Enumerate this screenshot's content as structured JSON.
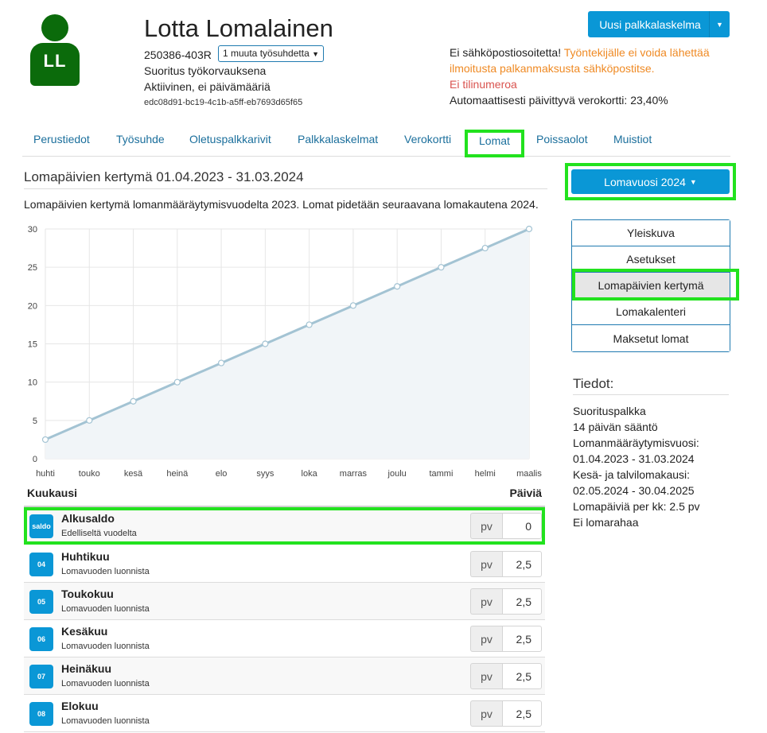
{
  "employee": {
    "initials": "LL",
    "name": "Lotta Lomalainen",
    "ssn": "250386-403R",
    "other_employments": "1 muuta työsuhdetta",
    "status_line1": "Suoritus työkorvauksena",
    "status_line2": "Aktiivinen, ei päivämääriä",
    "uuid": "edc08d91-bc19-4c1b-a5ff-eb7693d65f65",
    "avatar_color": "#0b6b0b"
  },
  "actions": {
    "new_payslip": "Uusi palkkalaskelma"
  },
  "notices": {
    "email_prefix": "Ei sähköpostiosoitetta! ",
    "email_warning": "Työntekijälle ei voida lähettää ilmoitusta palkanmaksusta sähköpostitse.",
    "no_account": "Ei tilinumeroa",
    "tax_card": "Automaattisesti päivittyvä verokortti: 23,40%"
  },
  "tabs": [
    {
      "label": "Perustiedot"
    },
    {
      "label": "Työsuhde"
    },
    {
      "label": "Oletuspalkkarivit"
    },
    {
      "label": "Palkkalaskelmat"
    },
    {
      "label": "Verokortti"
    },
    {
      "label": "Lomat",
      "active": true
    },
    {
      "label": "Poissaolot"
    },
    {
      "label": "Muistiot"
    }
  ],
  "main": {
    "title": "Lomapäivien kertymä 01.04.2023 - 31.03.2024",
    "description": "Lomapäivien kertymä lomanmääräytymisvuodelta 2023. Lomat pidetään seuraavana lomakautena 2024."
  },
  "chart_data": {
    "type": "area",
    "categories": [
      "huhti",
      "touko",
      "kesä",
      "heinä",
      "elo",
      "syys",
      "loka",
      "marras",
      "joulu",
      "tammi",
      "helmi",
      "maalis"
    ],
    "values": [
      2.5,
      5,
      7.5,
      10,
      12.5,
      15,
      17.5,
      20,
      22.5,
      25,
      27.5,
      30
    ],
    "yticks": [
      0,
      5,
      10,
      15,
      20,
      25,
      30
    ],
    "ylim": [
      0,
      30
    ],
    "grid": true,
    "line_color": "#a3c3d3",
    "fill_color": "#f1f5f8"
  },
  "table": {
    "col_month": "Kuukausi",
    "col_days": "Päiviä",
    "rows": [
      {
        "badge": "saldo",
        "title": "Alkusaldo",
        "sub": "Edelliseltä vuodelta",
        "unit": "pv",
        "value": "0"
      },
      {
        "badge": "04",
        "title": "Huhtikuu",
        "sub": "Lomavuoden luonnista",
        "unit": "pv",
        "value": "2,5"
      },
      {
        "badge": "05",
        "title": "Toukokuu",
        "sub": "Lomavuoden luonnista",
        "unit": "pv",
        "value": "2,5"
      },
      {
        "badge": "06",
        "title": "Kesäkuu",
        "sub": "Lomavuoden luonnista",
        "unit": "pv",
        "value": "2,5"
      },
      {
        "badge": "07",
        "title": "Heinäkuu",
        "sub": "Lomavuoden luonnista",
        "unit": "pv",
        "value": "2,5"
      },
      {
        "badge": "08",
        "title": "Elokuu",
        "sub": "Lomavuoden luonnista",
        "unit": "pv",
        "value": "2,5"
      }
    ]
  },
  "sidebar": {
    "year_button": "Lomavuosi 2024",
    "menu": [
      {
        "label": "Yleiskuva"
      },
      {
        "label": "Asetukset"
      },
      {
        "label": "Lomapäivien kertymä",
        "active": true
      },
      {
        "label": "Lomakalenteri"
      },
      {
        "label": "Maksetut lomat"
      }
    ],
    "details_title": "Tiedot:",
    "details": [
      "Suorituspalkka",
      "14 päivän sääntö",
      "Lomanmääräytymisvuosi:",
      "01.04.2023 - 31.03.2024",
      "Kesä- ja talvilomakausi:",
      "02.05.2024 - 30.04.2025",
      "Lomapäiviä per kk: 2.5 pv",
      "Ei lomarahaa"
    ]
  }
}
